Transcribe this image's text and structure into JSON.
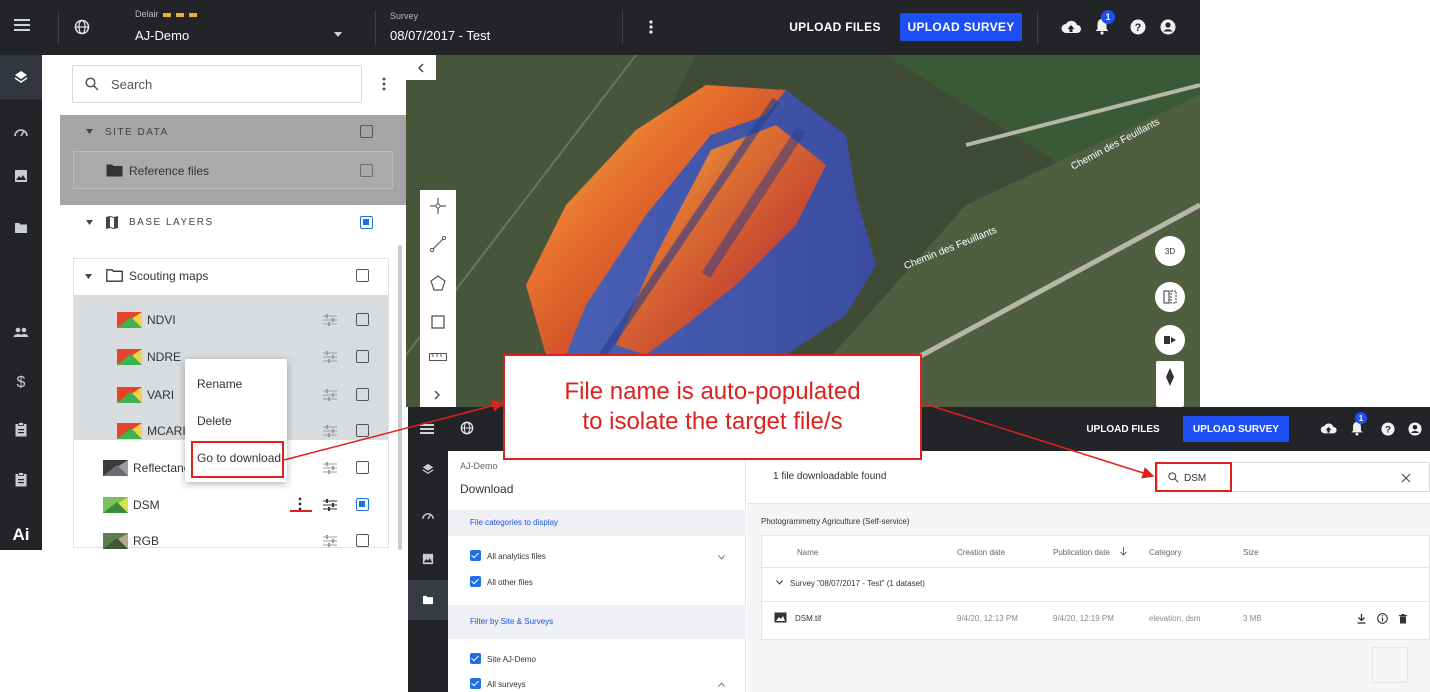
{
  "topbar": {
    "org": "Delair",
    "site": "AJ-Demo",
    "survey_label": "Survey",
    "survey_value": "08/07/2017 - Test",
    "upload_files": "UPLOAD FILES",
    "upload_survey": "UPLOAD SURVEY",
    "notification_count": "1",
    "icons": [
      "menu-icon",
      "globe-icon",
      "chevron-down-icon",
      "more-vert-icon",
      "cloud-upload-icon",
      "bell-icon",
      "help-icon",
      "account-icon"
    ]
  },
  "rail": {
    "items": [
      "layers-icon",
      "dashboard-icon",
      "image-icon",
      "folder-icon",
      "people-icon",
      "dollar-icon",
      "clipboard-icon",
      "clipboard-icon",
      "ai-icon"
    ],
    "ai_label": "Ai"
  },
  "layers": {
    "search_placeholder": "Search",
    "site_data": "SITE DATA",
    "reference_files": "Reference files",
    "base_layers": "BASE LAYERS",
    "scouting_maps": "Scouting maps",
    "items": [
      {
        "label": "NDVI",
        "checked": false
      },
      {
        "label": "NDRE",
        "checked": false
      },
      {
        "label": "VARI",
        "checked": false
      },
      {
        "label": "MCARI2",
        "checked": false
      },
      {
        "label": "Reflectance",
        "checked": false
      },
      {
        "label": "DSM",
        "checked": true
      },
      {
        "label": "RGB",
        "checked": false
      }
    ]
  },
  "context_menu": {
    "rename": "Rename",
    "delete": "Delete",
    "go_to_download": "Go to download"
  },
  "map": {
    "road_label_1": "Chemin des Feuillants",
    "road_label_2": "Chemin des Feuillants",
    "btn_3d": "3D",
    "tools": [
      "crosshair-icon",
      "polyline-icon",
      "polygon-icon",
      "rectangle-icon",
      "ruler-icon",
      "chevron-right-icon"
    ]
  },
  "annotation": {
    "line1": "File name is auto-populated",
    "line2": "to isolate the target file/s"
  },
  "download": {
    "topbar": {
      "upload_files": "UPLOAD FILES",
      "upload_survey": "UPLOAD SURVEY",
      "notification_count": "1"
    },
    "side": {
      "site": "AJ-Demo",
      "title": "Download",
      "categories_header": "File categories to display",
      "all_analytics": "All analytics files",
      "all_other": "All other files",
      "filter_header": "Filter by Site & Surveys",
      "site_filter": "Site AJ-Demo",
      "all_surveys": "All surveys"
    },
    "main": {
      "found_text": "1 file downloadable found",
      "search_value": "DSM",
      "group": "Photogrammetry Agriculture (Self-service)",
      "columns": [
        "Name",
        "Creation date",
        "Publication date",
        "Category",
        "Size"
      ],
      "survey_row": "Survey \"08/07/2017 - Test\" (1 dataset)",
      "file": {
        "name": "DSM.tif",
        "creation": "9/4/20, 12:13 PM",
        "publication": "9/4/20, 12:19 PM",
        "category": "elevation, dsm",
        "size": "3 MB"
      }
    }
  },
  "colors": {
    "dark": "#222428",
    "accent_blue": "#1e4ff5",
    "annotation_red": "#e0201c"
  }
}
